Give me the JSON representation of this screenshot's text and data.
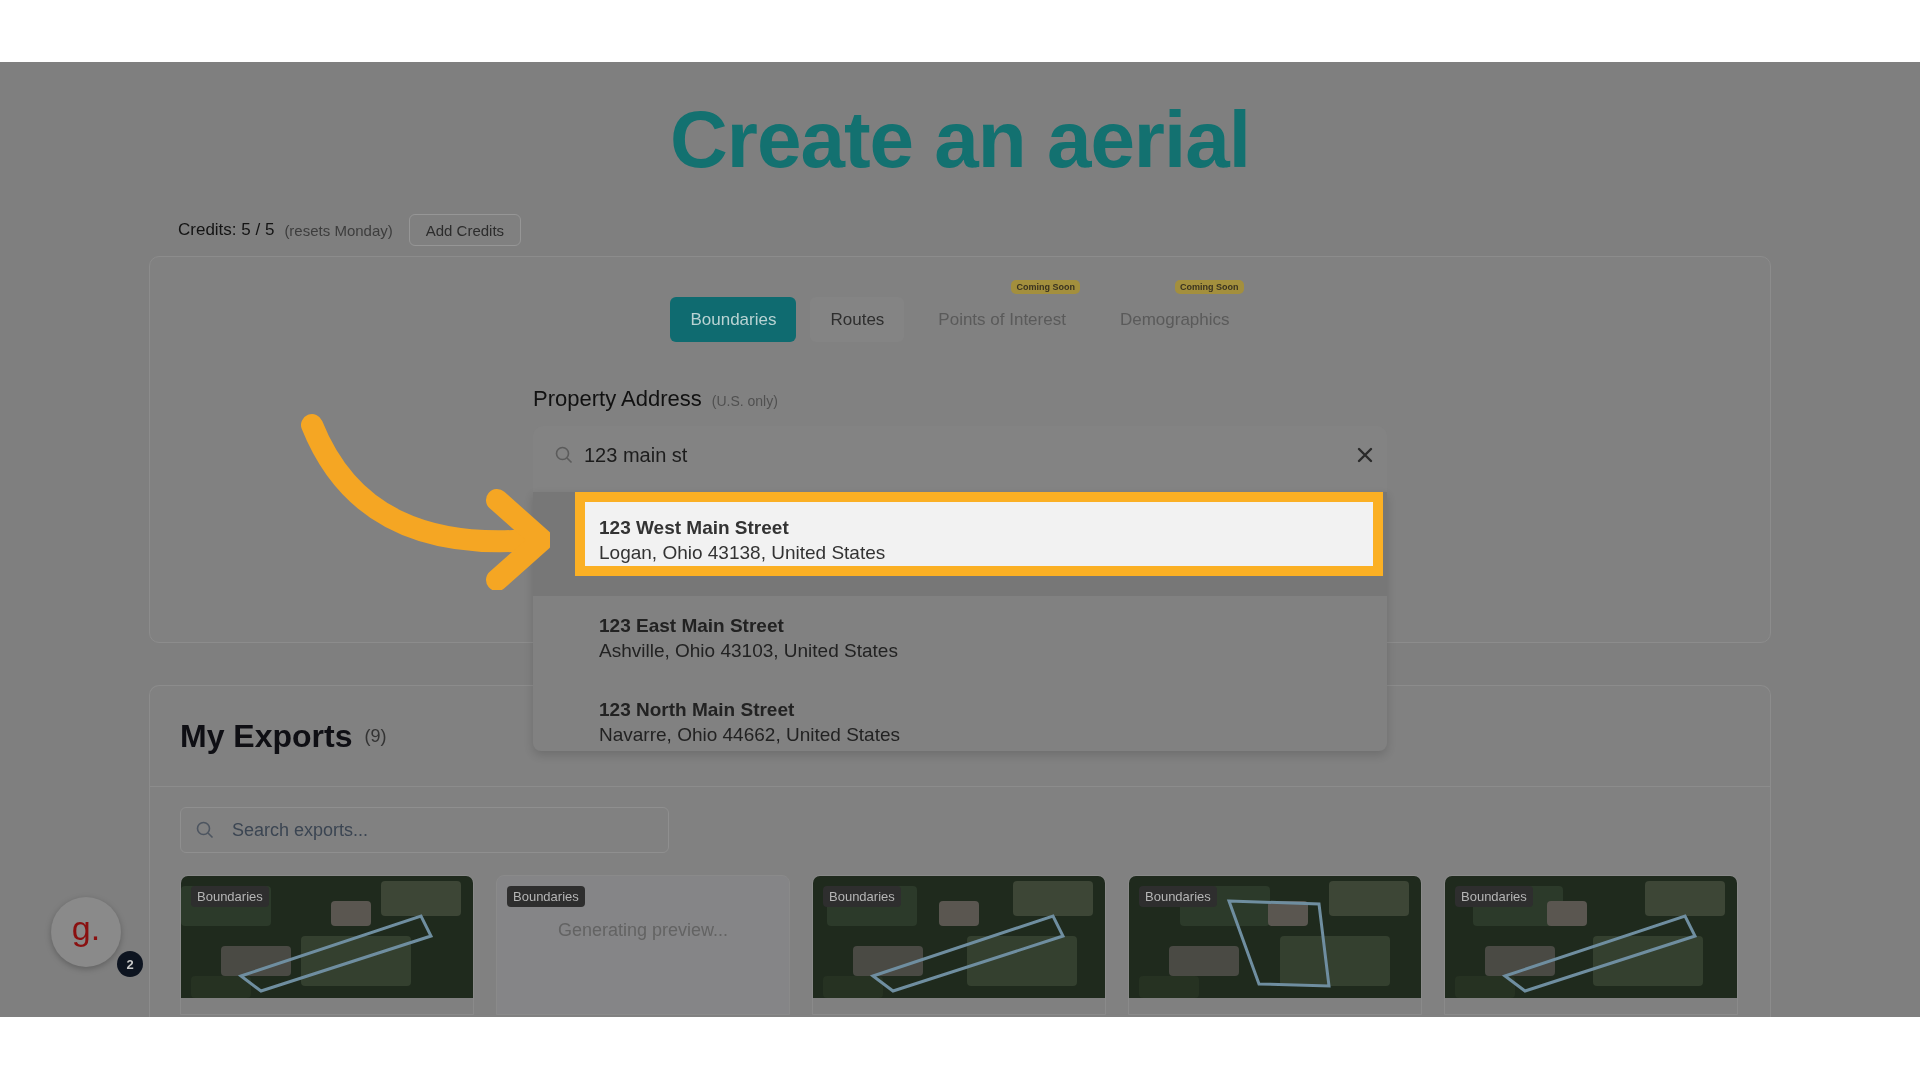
{
  "title": "Create an aerial",
  "credits": {
    "label": "Credits: 5 / 5",
    "note": "(resets Monday)",
    "button": "Add Credits"
  },
  "tabs": [
    {
      "label": "Boundaries",
      "selected": true,
      "disabled": false
    },
    {
      "label": "Routes",
      "selected": false,
      "disabled": false
    },
    {
      "label": "Points of Interest",
      "selected": false,
      "disabled": true,
      "badge": "Coming Soon"
    },
    {
      "label": "Demographics",
      "selected": false,
      "disabled": true,
      "badge": "Coming Soon"
    }
  ],
  "address": {
    "label": "Property Address",
    "note": "(U.S. only)",
    "value": "123 main st"
  },
  "suggestions": [
    {
      "street": "123 West Main Street",
      "place": "Logan, Ohio 43138, United States",
      "selected": true
    },
    {
      "street": "123 East Main Street",
      "place": "Ashville, Ohio 43103, United States",
      "selected": false
    },
    {
      "street": "123 North Main Street",
      "place": "Navarre, Ohio 44662, United States",
      "selected": false
    }
  ],
  "exports": {
    "title": "My Exports",
    "count": "(9)",
    "search_placeholder": "Search exports...",
    "items": [
      {
        "tag": "Boundaries",
        "kind": "picture"
      },
      {
        "tag": "Boundaries",
        "kind": "generating",
        "status": "Generating preview..."
      },
      {
        "tag": "Boundaries",
        "kind": "picture"
      },
      {
        "tag": "Boundaries",
        "kind": "picture"
      },
      {
        "tag": "Boundaries",
        "kind": "picture"
      }
    ]
  },
  "assistant": {
    "logo": "g.",
    "badge": "2"
  }
}
